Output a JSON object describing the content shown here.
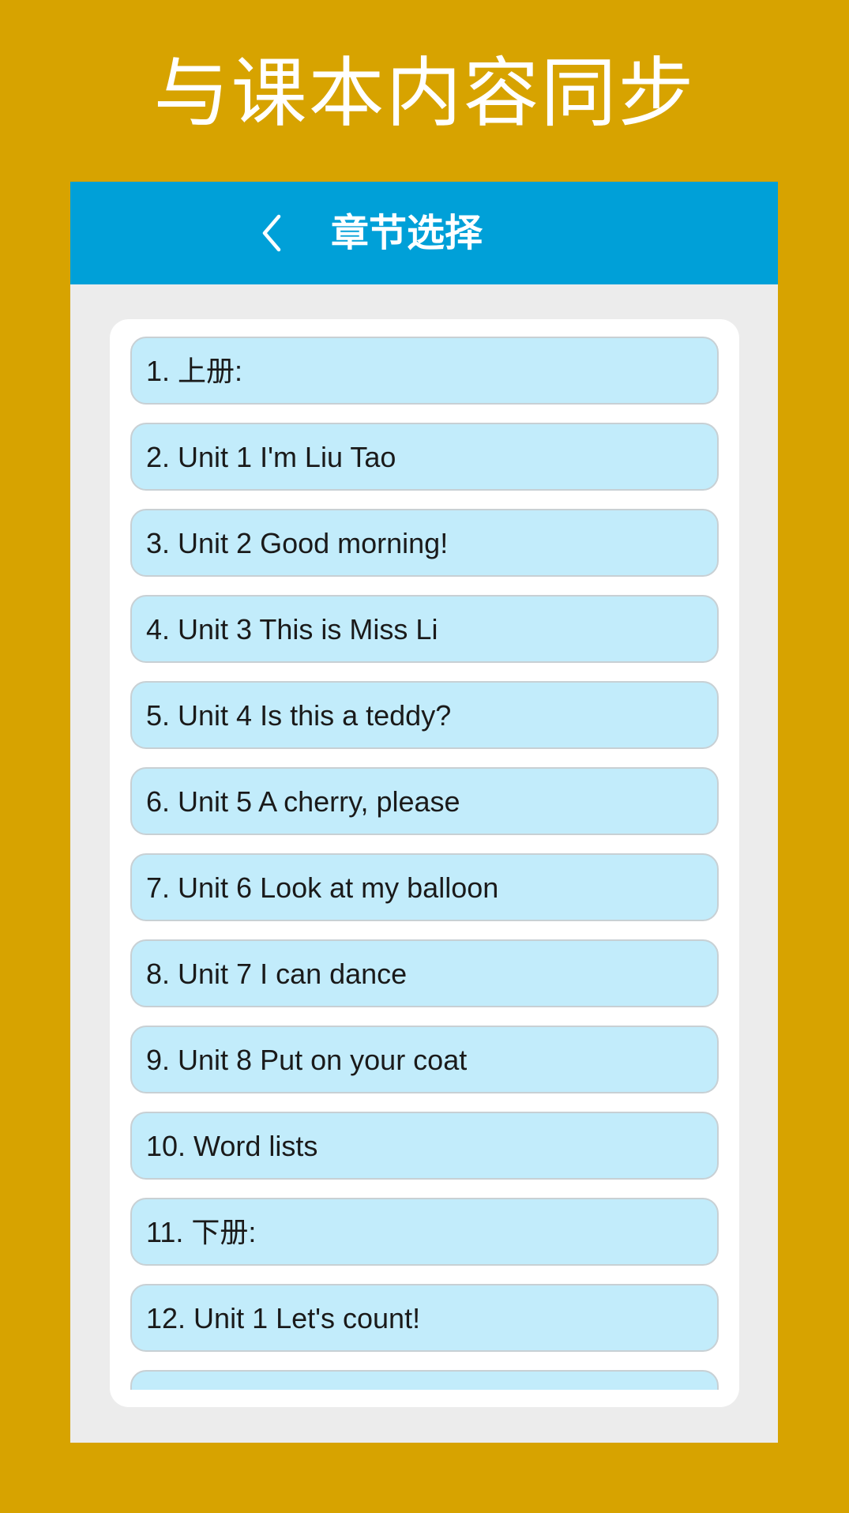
{
  "promo_title": "与课本内容同步",
  "header": {
    "title": "章节选择",
    "back_icon": "chevron-left-icon"
  },
  "colors": {
    "background": "#d7a300",
    "header": "#00a0d8",
    "item": "#c2ecfb"
  },
  "chapters": [
    "1. 上册:",
    "2. Unit 1 I'm Liu Tao",
    "3. Unit 2 Good morning!",
    "4. Unit 3 This is Miss Li",
    "5. Unit 4 Is this a teddy?",
    "6. Unit 5 A cherry, please",
    "7. Unit 6 Look at my balloon",
    "8. Unit 7 I can dance",
    "9. Unit 8 Put on your coat",
    "10. Word lists",
    "11. 下册:",
    "12. Unit 1 Let's count!",
    ""
  ]
}
